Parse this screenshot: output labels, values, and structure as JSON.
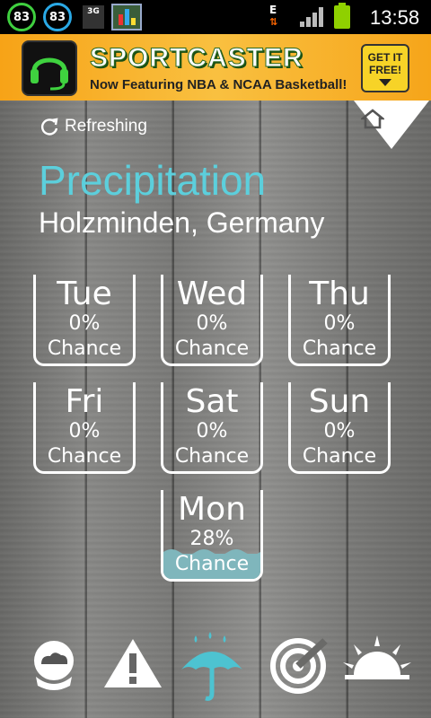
{
  "status_bar": {
    "badge1": "83",
    "badge2": "83",
    "network_3g": "3G",
    "data_indicator": "E",
    "time": "13:58"
  },
  "ad": {
    "title": "SPORTCASTER",
    "subtitle": "Now Featuring NBA & NCAA Basketball!",
    "cta_line1": "GET IT",
    "cta_line2": "FREE!"
  },
  "header": {
    "refresh_text": "Refreshing",
    "title": "Precipitation",
    "location": "Holzminden, Germany"
  },
  "days": [
    {
      "name": "Tue",
      "percent": "0%",
      "label": "Chance",
      "fill_fraction": 0.0
    },
    {
      "name": "Wed",
      "percent": "0%",
      "label": "Chance",
      "fill_fraction": 0.0
    },
    {
      "name": "Thu",
      "percent": "0%",
      "label": "Chance",
      "fill_fraction": 0.0
    },
    {
      "name": "Fri",
      "percent": "0%",
      "label": "Chance",
      "fill_fraction": 0.0
    },
    {
      "name": "Sat",
      "percent": "0%",
      "label": "Chance",
      "fill_fraction": 0.0
    },
    {
      "name": "Sun",
      "percent": "0%",
      "label": "Chance",
      "fill_fraction": 0.0
    },
    {
      "name": "Mon",
      "percent": "28%",
      "label": "Chance",
      "fill_fraction": 0.28
    }
  ],
  "bottom_nav": [
    {
      "icon": "forecast-globe-icon",
      "active": false
    },
    {
      "icon": "warning-icon",
      "active": false
    },
    {
      "icon": "umbrella-rain-icon",
      "active": true
    },
    {
      "icon": "radar-icon",
      "active": false
    },
    {
      "icon": "sunrise-icon",
      "active": false
    }
  ],
  "colors": {
    "accent": "#5ccfdc",
    "fill": "#7fb6bc",
    "active_icon": "#4dc3d1",
    "icon": "#ffffff"
  }
}
